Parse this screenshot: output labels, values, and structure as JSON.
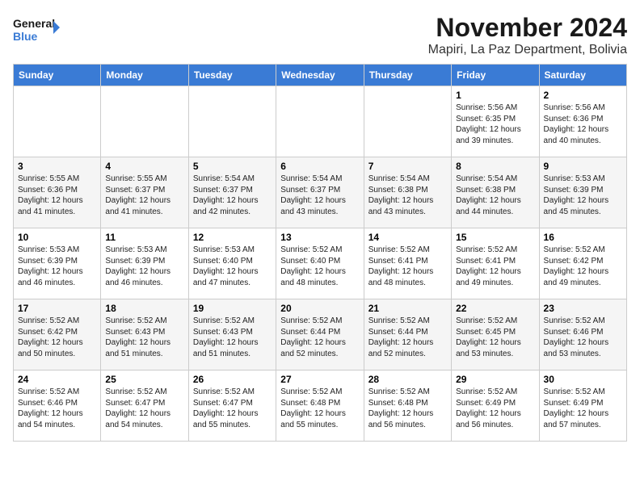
{
  "logo": {
    "line1": "General",
    "line2": "Blue"
  },
  "title": "November 2024",
  "subtitle": "Mapiri, La Paz Department, Bolivia",
  "weekdays": [
    "Sunday",
    "Monday",
    "Tuesday",
    "Wednesday",
    "Thursday",
    "Friday",
    "Saturday"
  ],
  "weeks": [
    [
      {
        "day": "",
        "info": ""
      },
      {
        "day": "",
        "info": ""
      },
      {
        "day": "",
        "info": ""
      },
      {
        "day": "",
        "info": ""
      },
      {
        "day": "",
        "info": ""
      },
      {
        "day": "1",
        "info": "Sunrise: 5:56 AM\nSunset: 6:35 PM\nDaylight: 12 hours and 39 minutes."
      },
      {
        "day": "2",
        "info": "Sunrise: 5:56 AM\nSunset: 6:36 PM\nDaylight: 12 hours and 40 minutes."
      }
    ],
    [
      {
        "day": "3",
        "info": "Sunrise: 5:55 AM\nSunset: 6:36 PM\nDaylight: 12 hours and 41 minutes."
      },
      {
        "day": "4",
        "info": "Sunrise: 5:55 AM\nSunset: 6:37 PM\nDaylight: 12 hours and 41 minutes."
      },
      {
        "day": "5",
        "info": "Sunrise: 5:54 AM\nSunset: 6:37 PM\nDaylight: 12 hours and 42 minutes."
      },
      {
        "day": "6",
        "info": "Sunrise: 5:54 AM\nSunset: 6:37 PM\nDaylight: 12 hours and 43 minutes."
      },
      {
        "day": "7",
        "info": "Sunrise: 5:54 AM\nSunset: 6:38 PM\nDaylight: 12 hours and 43 minutes."
      },
      {
        "day": "8",
        "info": "Sunrise: 5:54 AM\nSunset: 6:38 PM\nDaylight: 12 hours and 44 minutes."
      },
      {
        "day": "9",
        "info": "Sunrise: 5:53 AM\nSunset: 6:39 PM\nDaylight: 12 hours and 45 minutes."
      }
    ],
    [
      {
        "day": "10",
        "info": "Sunrise: 5:53 AM\nSunset: 6:39 PM\nDaylight: 12 hours and 46 minutes."
      },
      {
        "day": "11",
        "info": "Sunrise: 5:53 AM\nSunset: 6:39 PM\nDaylight: 12 hours and 46 minutes."
      },
      {
        "day": "12",
        "info": "Sunrise: 5:53 AM\nSunset: 6:40 PM\nDaylight: 12 hours and 47 minutes."
      },
      {
        "day": "13",
        "info": "Sunrise: 5:52 AM\nSunset: 6:40 PM\nDaylight: 12 hours and 48 minutes."
      },
      {
        "day": "14",
        "info": "Sunrise: 5:52 AM\nSunset: 6:41 PM\nDaylight: 12 hours and 48 minutes."
      },
      {
        "day": "15",
        "info": "Sunrise: 5:52 AM\nSunset: 6:41 PM\nDaylight: 12 hours and 49 minutes."
      },
      {
        "day": "16",
        "info": "Sunrise: 5:52 AM\nSunset: 6:42 PM\nDaylight: 12 hours and 49 minutes."
      }
    ],
    [
      {
        "day": "17",
        "info": "Sunrise: 5:52 AM\nSunset: 6:42 PM\nDaylight: 12 hours and 50 minutes."
      },
      {
        "day": "18",
        "info": "Sunrise: 5:52 AM\nSunset: 6:43 PM\nDaylight: 12 hours and 51 minutes."
      },
      {
        "day": "19",
        "info": "Sunrise: 5:52 AM\nSunset: 6:43 PM\nDaylight: 12 hours and 51 minutes."
      },
      {
        "day": "20",
        "info": "Sunrise: 5:52 AM\nSunset: 6:44 PM\nDaylight: 12 hours and 52 minutes."
      },
      {
        "day": "21",
        "info": "Sunrise: 5:52 AM\nSunset: 6:44 PM\nDaylight: 12 hours and 52 minutes."
      },
      {
        "day": "22",
        "info": "Sunrise: 5:52 AM\nSunset: 6:45 PM\nDaylight: 12 hours and 53 minutes."
      },
      {
        "day": "23",
        "info": "Sunrise: 5:52 AM\nSunset: 6:46 PM\nDaylight: 12 hours and 53 minutes."
      }
    ],
    [
      {
        "day": "24",
        "info": "Sunrise: 5:52 AM\nSunset: 6:46 PM\nDaylight: 12 hours and 54 minutes."
      },
      {
        "day": "25",
        "info": "Sunrise: 5:52 AM\nSunset: 6:47 PM\nDaylight: 12 hours and 54 minutes."
      },
      {
        "day": "26",
        "info": "Sunrise: 5:52 AM\nSunset: 6:47 PM\nDaylight: 12 hours and 55 minutes."
      },
      {
        "day": "27",
        "info": "Sunrise: 5:52 AM\nSunset: 6:48 PM\nDaylight: 12 hours and 55 minutes."
      },
      {
        "day": "28",
        "info": "Sunrise: 5:52 AM\nSunset: 6:48 PM\nDaylight: 12 hours and 56 minutes."
      },
      {
        "day": "29",
        "info": "Sunrise: 5:52 AM\nSunset: 6:49 PM\nDaylight: 12 hours and 56 minutes."
      },
      {
        "day": "30",
        "info": "Sunrise: 5:52 AM\nSunset: 6:49 PM\nDaylight: 12 hours and 57 minutes."
      }
    ]
  ]
}
